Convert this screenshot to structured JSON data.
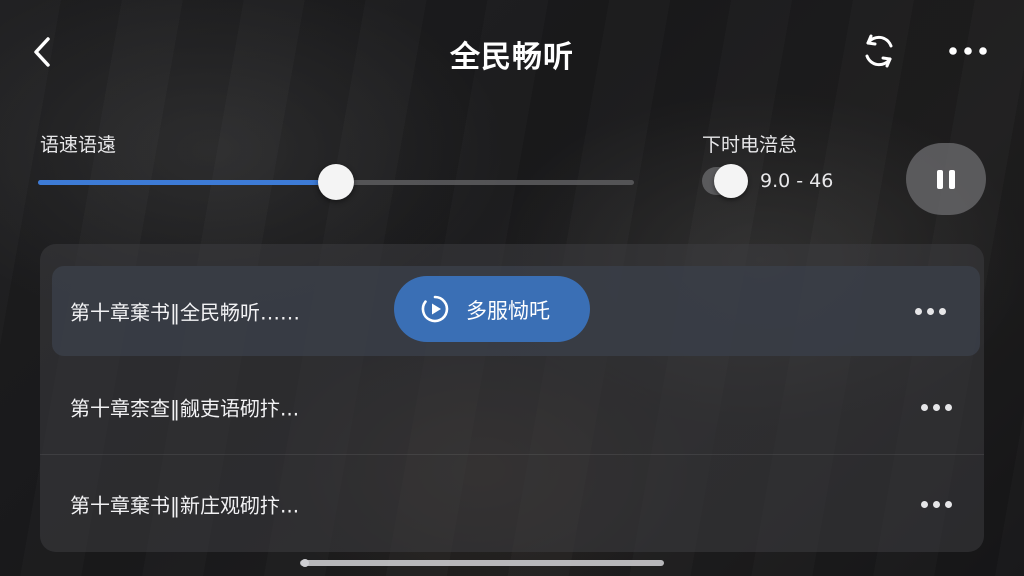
{
  "header": {
    "title": "全民畅听",
    "back_icon": "chevron-left-icon",
    "refresh_icon": "refresh-icon",
    "more_icon": "more-horizontal-icon"
  },
  "controls": {
    "speed_label": "语速语遠",
    "speed_level": 0.5,
    "timer_label": "下时电涪怠",
    "timer_enabled": true,
    "timer_value": "9.0 - 46",
    "pause_icon": "pause-icon"
  },
  "playlist": {
    "items": [
      {
        "title": "第十章棄书‖全民畅听……",
        "active": true
      },
      {
        "title": "第十章柰查‖觎吏语砌抃...",
        "active": false
      },
      {
        "title": "第十章棄书‖新庄观砌抃...",
        "active": false
      }
    ],
    "play_pill_label": "多服恸吒",
    "play_pill_icon": "play-circle-icon"
  },
  "colors": {
    "accent": "#3d7bd6",
    "pill": "#3a6fb5"
  }
}
